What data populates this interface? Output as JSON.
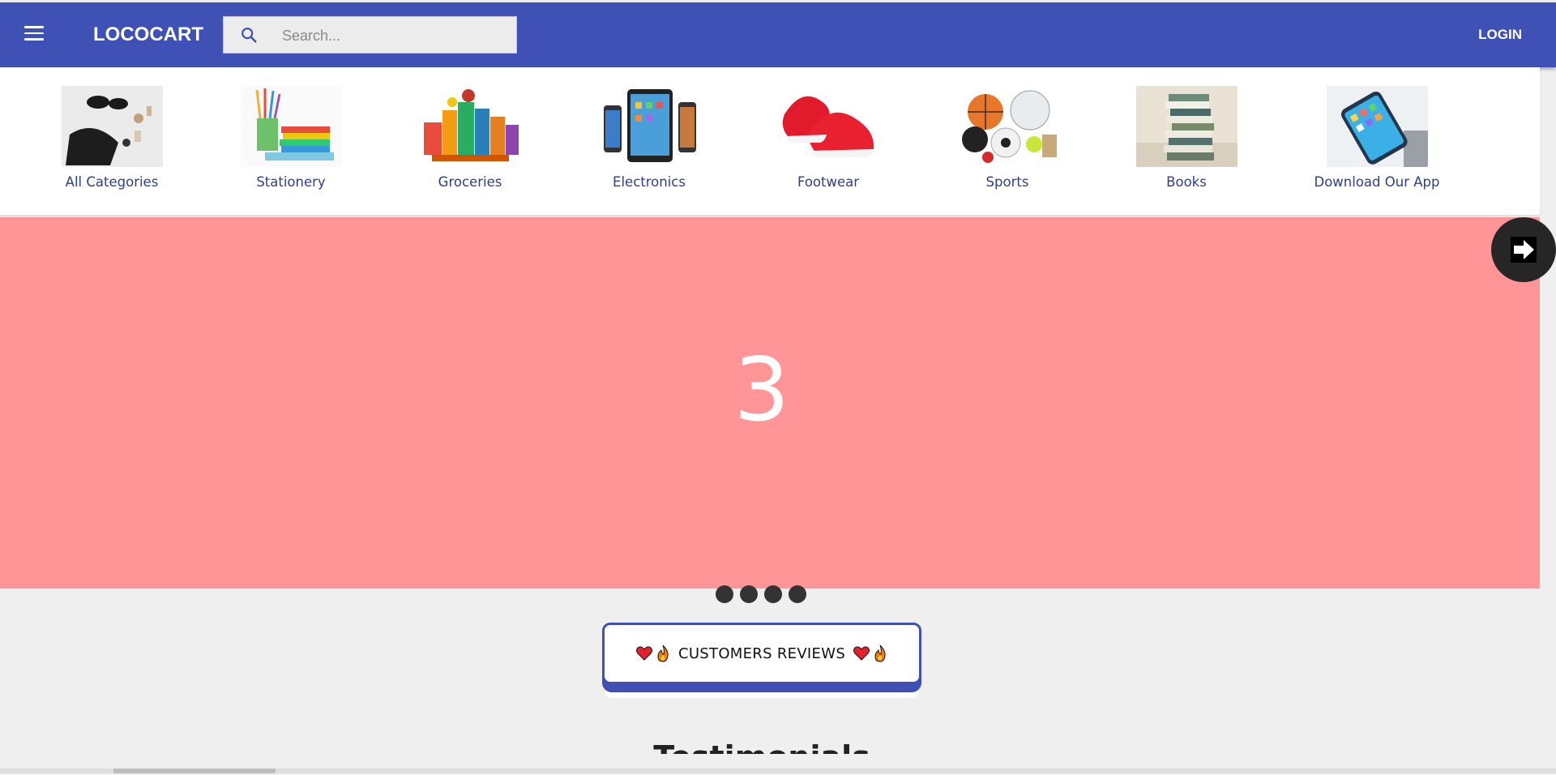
{
  "header": {
    "brand": "LOCOCART",
    "search_placeholder": "Search...",
    "login_label": "LOGIN",
    "colors": {
      "bar": "#3f51b5"
    }
  },
  "categories": [
    {
      "label": "All Categories",
      "icon": "accessories-image"
    },
    {
      "label": "Stationery",
      "icon": "stationery-image"
    },
    {
      "label": "Groceries",
      "icon": "groceries-image"
    },
    {
      "label": "Electronics",
      "icon": "devices-image"
    },
    {
      "label": "Footwear",
      "icon": "red-sneakers-image"
    },
    {
      "label": "Sports",
      "icon": "sports-balls-image"
    },
    {
      "label": "Books",
      "icon": "book-stack-image"
    },
    {
      "label": "Download Our App",
      "icon": "smartphone-image"
    }
  ],
  "carousel": {
    "current_slide": "3",
    "slide_count": 4,
    "next_icon": "arrow-right-icon",
    "background": "#ff9596"
  },
  "reviews_button": {
    "label": "CUSTOMERS REVIEWS"
  },
  "section_heading": "Testimonials"
}
